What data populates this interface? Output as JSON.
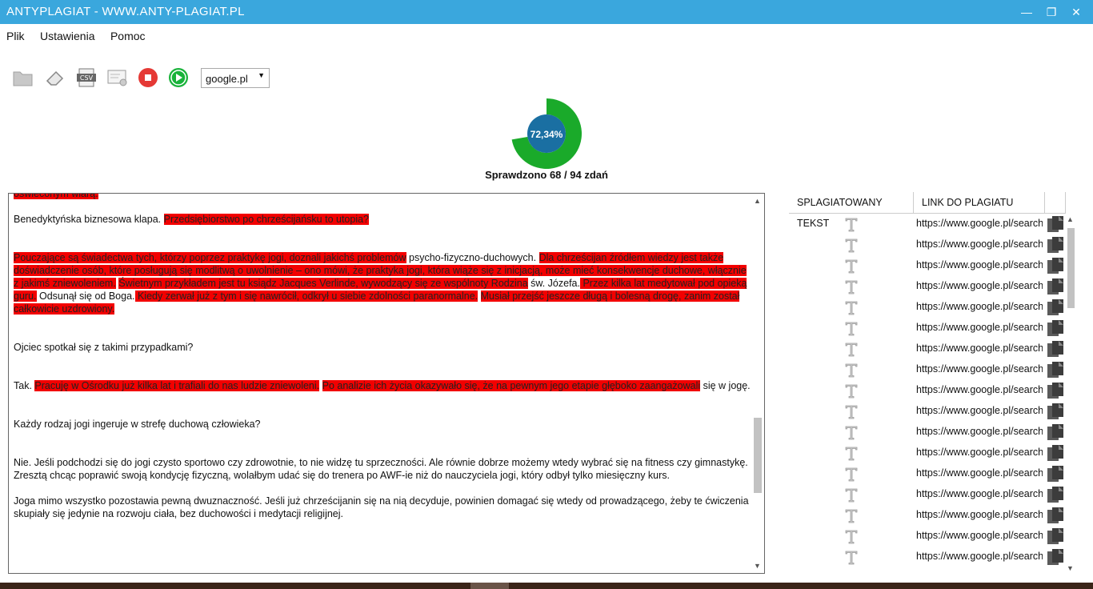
{
  "window": {
    "title": "ANTYPLAGIAT - WWW.ANTY-PLAGIAT.PL"
  },
  "menu": {
    "items": [
      "Plik",
      "Ustawienia",
      "Pomoc"
    ]
  },
  "toolbar": {
    "engine": "google.pl"
  },
  "progress": {
    "percent_label": "72,34%",
    "fraction": 0.7234,
    "caption": "Sprawdzono 68 / 94 zdań"
  },
  "colors": {
    "titlebar": "#3aa7dd",
    "highlight": "#f20000",
    "gauge_green": "#1aaa2a",
    "gauge_center": "#1a6fa2",
    "stop_red": "#e53935",
    "play_green": "#19b33a"
  },
  "text": {
    "p0": [
      {
        "t": "oświeconym wiarą.",
        "h": true
      }
    ],
    "p1": [
      {
        "t": "Benedyktyńska biznesowa klapa. ",
        "h": false
      },
      {
        "t": "Przedsiębiorstwo po chrześcijańsku to utopia?",
        "h": true
      }
    ],
    "p2": [
      {
        "t": "Pouczające są świadectwa tych, którzy poprzez praktykę jogi, doznali jakichś problemów",
        "h": true
      },
      {
        "t": " psycho-fizyczno-duchowych. ",
        "h": false
      },
      {
        "t": "Dla chrześcijan źródłem wiedzy jest także doświadczenie osób, które posługują się modlitwą o uwolnienie – ono mówi, że praktyka jogi, która wiąże się z inicjacją, może mieć konsekwencje duchowe, włącznie z jakimś zniewoleniem.",
        "h": true
      },
      {
        "t": " ",
        "h": false
      },
      {
        "t": "Świetnym przykładem jest tu ksiądz Jacques Verlinde, wywodzący się ze wspólnoty Rodzina",
        "h": true
      },
      {
        "t": " św. Józefa.",
        "h": false
      },
      {
        "t": " Przez kilka lat medytował pod opieką guru.",
        "h": true
      },
      {
        "t": " Odsunął się od Boga.",
        "h": false
      },
      {
        "t": " Kiedy zerwał już z tym i się nawrócił, odkrył u siebie zdolności paranormalne.",
        "h": true
      },
      {
        "t": " ",
        "h": false
      },
      {
        "t": "Musiał przejść jeszcze długą i bolesną drogę, zanim został całkowicie uzdrowiony.",
        "h": true
      }
    ],
    "p3": [
      {
        "t": "Ojciec spotkał się z takimi przypadkami?",
        "h": false
      }
    ],
    "p4": [
      {
        "t": "Tak. ",
        "h": false
      },
      {
        "t": "Pracuję w Ośrodku już kilka lat i trafiali do nas ludzie zniewoleni.",
        "h": true
      },
      {
        "t": " ",
        "h": false
      },
      {
        "t": "Po analizie ich życia okazywało się, że na pewnym jego etapie głęboko zaangażowali",
        "h": true
      },
      {
        "t": " się w jogę.",
        "h": false
      }
    ],
    "p5": [
      {
        "t": "Każdy rodzaj jogi ingeruje w strefę duchową człowieka?",
        "h": false
      }
    ],
    "p6": [
      {
        "t": "Nie. Jeśli podchodzi się do jogi czysto sportowo czy zdrowotnie, to nie widzę tu sprzeczności. Ale równie dobrze możemy wtedy wybrać się na fitness czy gimnastykę. Zresztą chcąc poprawić swoją kondycję fizyczną, wolałbym udać się do trenera po AWF-ie niż do nauczyciela jogi, który odbył tylko miesięczny kurs.",
        "h": false
      }
    ],
    "p7": [
      {
        "t": "Joga mimo wszystko pozostawia pewną dwuznaczność. Jeśli już chrześcijanin się na nią decyduje, powinien domagać się wtedy od prowadzącego, żeby te ćwiczenia skupiały się jedynie na rozwoju ciała, bez duchowości i medytacji religijnej.",
        "h": false
      }
    ]
  },
  "table": {
    "headers": [
      "SPLAGIATOWANY TEKST",
      "LINK DO PLAGIATU"
    ],
    "rows": [
      "https://www.google.pl/search?",
      "https://www.google.pl/search?",
      "https://www.google.pl/search?",
      "https://www.google.pl/search?",
      "https://www.google.pl/search?",
      "https://www.google.pl/search?",
      "https://www.google.pl/search?",
      "https://www.google.pl/search?",
      "https://www.google.pl/search?",
      "https://www.google.pl/search?",
      "https://www.google.pl/search?",
      "https://www.google.pl/search?",
      "https://www.google.pl/search?",
      "https://www.google.pl/search?",
      "https://www.google.pl/search?",
      "https://www.google.pl/search?",
      "https://www.google.pl/search?"
    ]
  }
}
